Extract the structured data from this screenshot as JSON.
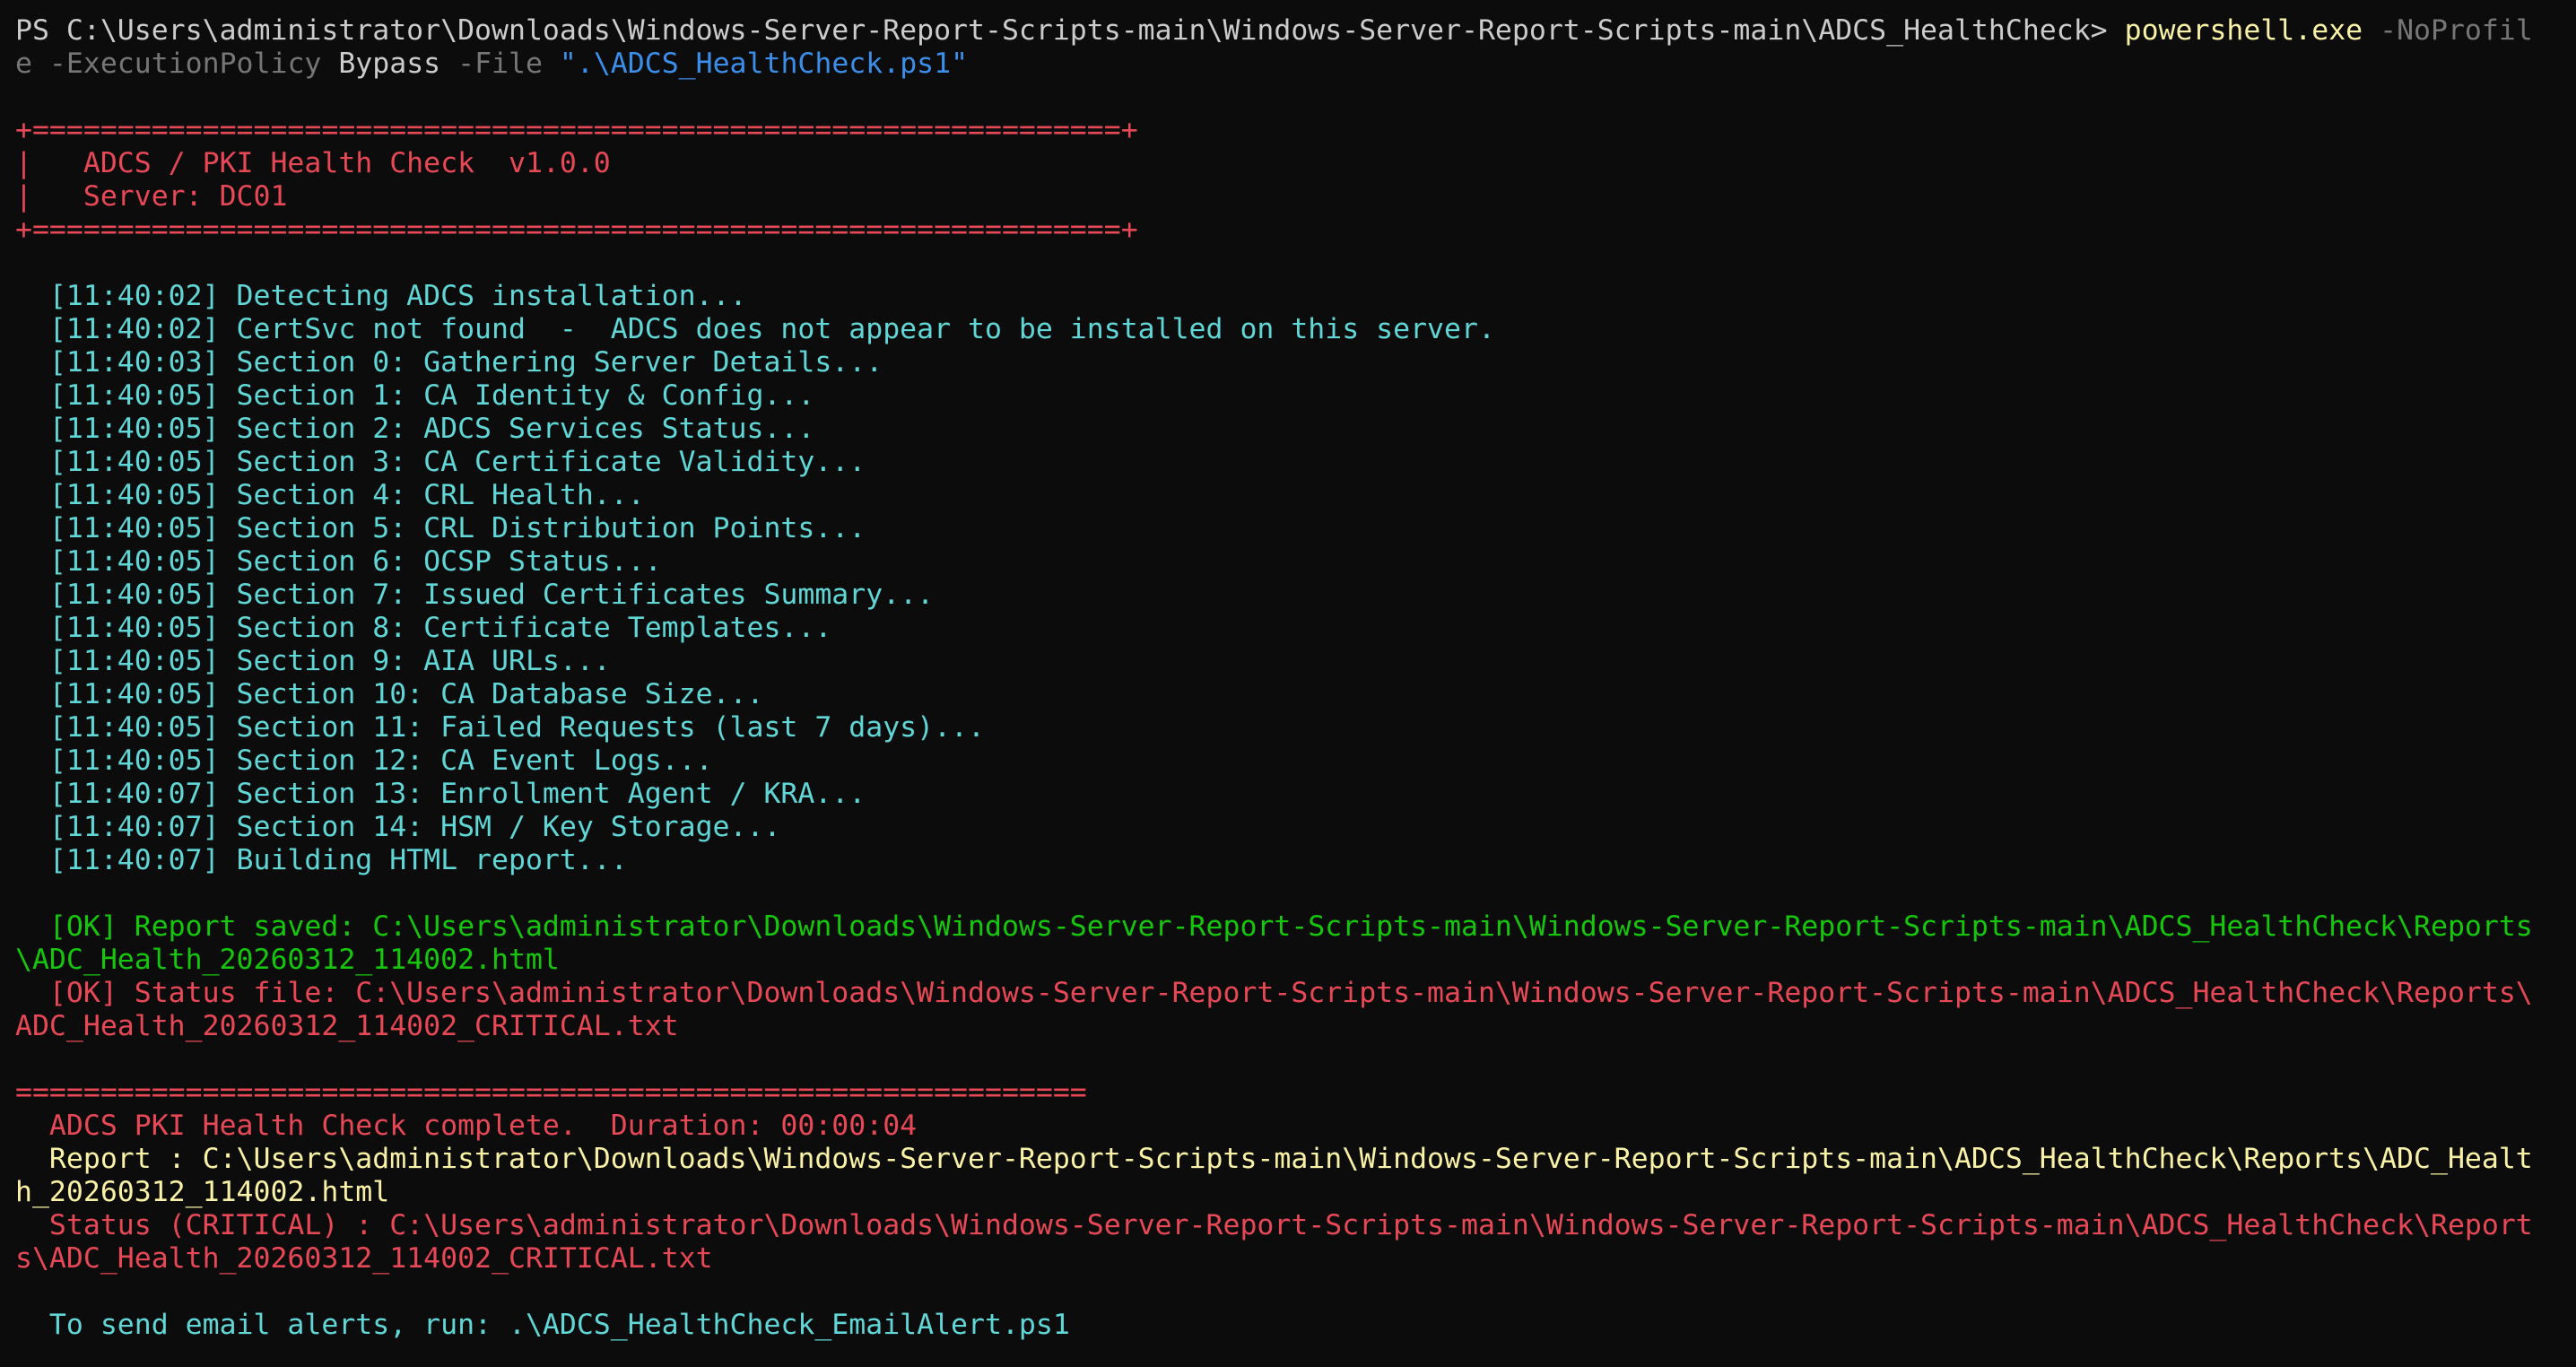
{
  "prompt": {
    "path": "PS C:\\Users\\administrator\\Downloads\\Windows-Server-Report-Scripts-main\\Windows-Server-Report-Scripts-main\\ADCS_HealthCheck> ",
    "command": "powershell.exe",
    "arg_noprofile_part1": " -NoProfil",
    "arg_noprofile_part2": "e",
    "arg_executionpolicy": " -ExecutionPolicy",
    "policy_value": " Bypass",
    "arg_file": " -File",
    "file_value": " \".\\ADCS_HealthCheck.ps1\""
  },
  "banner": {
    "border": "+================================================================+",
    "title_line": "|   ADCS / PKI Health Check  v1.0.0",
    "server_line": "|   Server: DC01"
  },
  "log_lines": [
    "  [11:40:02] Detecting ADCS installation...",
    "  [11:40:02] CertSvc not found  -  ADCS does not appear to be installed on this server.",
    "  [11:40:03] Section 0: Gathering Server Details...",
    "  [11:40:05] Section 1: CA Identity & Config...",
    "  [11:40:05] Section 2: ADCS Services Status...",
    "  [11:40:05] Section 3: CA Certificate Validity...",
    "  [11:40:05] Section 4: CRL Health...",
    "  [11:40:05] Section 5: CRL Distribution Points...",
    "  [11:40:05] Section 6: OCSP Status...",
    "  [11:40:05] Section 7: Issued Certificates Summary...",
    "  [11:40:05] Section 8: Certificate Templates...",
    "  [11:40:05] Section 9: AIA URLs...",
    "  [11:40:05] Section 10: CA Database Size...",
    "  [11:40:05] Section 11: Failed Requests (last 7 days)...",
    "  [11:40:05] Section 12: CA Event Logs...",
    "  [11:40:07] Section 13: Enrollment Agent / KRA...",
    "  [11:40:07] Section 14: HSM / Key Storage...",
    "  [11:40:07] Building HTML report..."
  ],
  "ok_report": {
    "line1": "  [OK] Report saved: C:\\Users\\administrator\\Downloads\\Windows-Server-Report-Scripts-main\\Windows-Server-Report-Scripts-main\\ADCS_HealthCheck\\Reports",
    "line2": "\\ADC_Health_20260312_114002.html"
  },
  "ok_status": {
    "line1": "  [OK] Status file: C:\\Users\\administrator\\Downloads\\Windows-Server-Report-Scripts-main\\Windows-Server-Report-Scripts-main\\ADCS_HealthCheck\\Reports\\",
    "line2": "ADC_Health_20260312_114002_CRITICAL.txt"
  },
  "summary": {
    "separator": "===============================================================",
    "complete_line": "  ADCS PKI Health Check complete.  Duration: 00:00:04",
    "report_line1": "  Report : C:\\Users\\administrator\\Downloads\\Windows-Server-Report-Scripts-main\\Windows-Server-Report-Scripts-main\\ADCS_HealthCheck\\Reports\\ADC_Healt",
    "report_line2": "h_20260312_114002.html",
    "status_line1": "  Status (CRITICAL) : C:\\Users\\administrator\\Downloads\\Windows-Server-Report-Scripts-main\\Windows-Server-Report-Scripts-main\\ADCS_HealthCheck\\Report",
    "status_line2": "s\\ADC_Health_20260312_114002_CRITICAL.txt",
    "email_hint": "  To send email alerts, run: .\\ADCS_HealthCheck_EmailAlert.ps1"
  },
  "colors": {
    "background": "#0c0c0c",
    "default_text": "#cccccc",
    "command": "#f9f1a5",
    "parameter": "#767676",
    "string": "#3b8eea",
    "banner": "#e74856",
    "log": "#61d6d6",
    "ok": "#16c60c",
    "status": "#e74856",
    "report": "#f9f1a5"
  }
}
